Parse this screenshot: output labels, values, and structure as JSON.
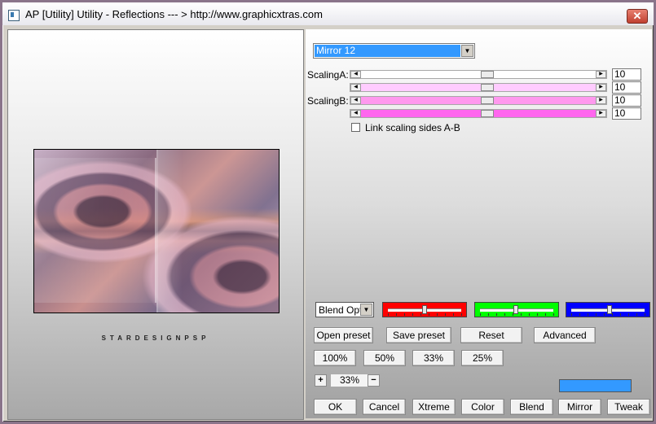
{
  "window": {
    "title": "AP [Utility]  Utility - Reflections    --- > http://www.graphicxtras.com",
    "close_label": "✕"
  },
  "preview": {
    "signature": "STARDESIGNPSP"
  },
  "preset": {
    "selected": "Mirror 12"
  },
  "scaling": {
    "label_a": "ScalingA:",
    "label_b": "ScalingB:",
    "sliders": [
      {
        "value": "10",
        "track_color": "#ffffff"
      },
      {
        "value": "10",
        "track_color": "#ffccff"
      },
      {
        "value": "10",
        "track_color": "#ff99ee"
      },
      {
        "value": "10",
        "track_color": "#ff66ee"
      }
    ],
    "link_label": "Link scaling sides A-B",
    "link_checked": false
  },
  "blend": {
    "select_value": "Blend Options",
    "red_color": "#ff0000",
    "green_color": "#00ff00",
    "blue_color": "#0000ff"
  },
  "buttons": {
    "open_preset": "Open preset",
    "save_preset": "Save preset",
    "reset": "Reset",
    "advanced": "Advanced",
    "ok": "OK",
    "cancel": "Cancel",
    "xtreme": "Xtreme",
    "color": "Color",
    "blend": "Blend",
    "mirror": "Mirror",
    "tweak": "Tweak"
  },
  "zoom": {
    "presets": [
      "100%",
      "50%",
      "33%",
      "25%"
    ],
    "plus_label": "+",
    "minus_label": "−",
    "current": "33%"
  },
  "color_swatch": "#3399ff",
  "icons": {
    "app": "app-window-icon",
    "close": "close-icon",
    "dropdown": "chevron-down-icon",
    "scroll_left": "arrow-left-icon",
    "scroll_right": "arrow-right-icon"
  }
}
